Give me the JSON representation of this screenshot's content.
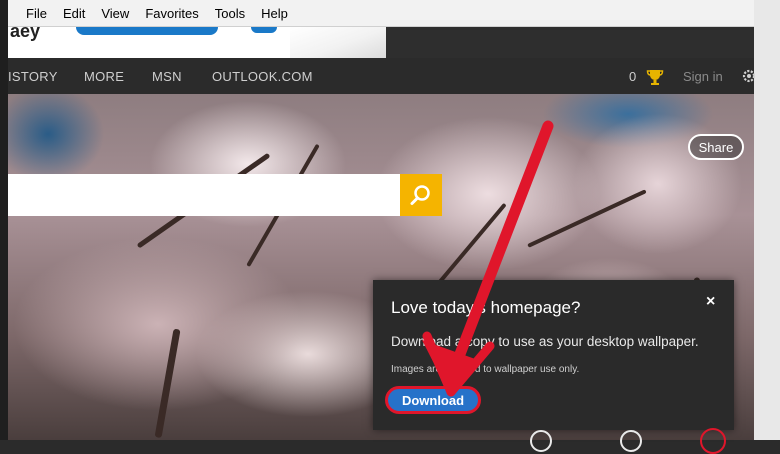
{
  "menu": {
    "items": [
      "File",
      "Edit",
      "View",
      "Favorites",
      "Tools",
      "Help"
    ]
  },
  "banner": {
    "partial_text": "aey"
  },
  "nav": {
    "history": "ISTORY",
    "more": "MORE",
    "msn": "MSN",
    "outlook": "OUTLOOK.COM",
    "reward_count": "0",
    "sign_in": "Sign in"
  },
  "search": {
    "placeholder": ""
  },
  "share_label": "Share",
  "popup": {
    "title": "Love today's homepage?",
    "body": "Download a copy to use as your desktop wallpaper.",
    "note": "Images are licensed to wallpaper use only.",
    "close": "×",
    "download_label": "Download"
  },
  "colors": {
    "search_button": "#f5b400",
    "download_button": "#2672c9",
    "annotation_red": "#e0162b",
    "popup_bg": "#2a2a2a"
  },
  "icons": {
    "search": "magnifier-icon",
    "trophy": "trophy-icon",
    "settings": "gear-icon",
    "close": "close-icon"
  }
}
